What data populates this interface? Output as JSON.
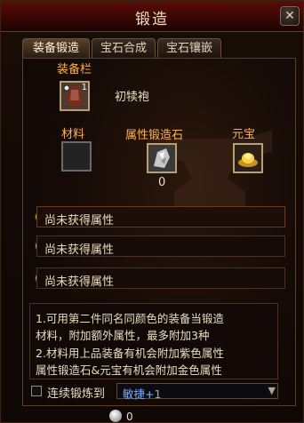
{
  "window": {
    "title": "锻造",
    "close_glyph": "✕"
  },
  "tabs": [
    {
      "label": "装备锻造",
      "active": true
    },
    {
      "label": "宝石合成",
      "active": false
    },
    {
      "label": "宝石镶嵌",
      "active": false
    }
  ],
  "equipment": {
    "label": "装备栏",
    "item_name": "初犊袍",
    "count": "1"
  },
  "material": {
    "label": "材料"
  },
  "forge_stone": {
    "label": "属性锻造石",
    "count": "0"
  },
  "yuanbao": {
    "label": "元宝"
  },
  "attributes": [
    {
      "text": "尚未获得属性",
      "icon": "gold-coin-icon"
    },
    {
      "text": "尚未获得属性",
      "icon": "silver-coin-icon"
    },
    {
      "text": "尚未获得属性",
      "icon": "silver-coin-icon"
    }
  ],
  "info_lines": [
    "1.可用第二件同名同颜色的装备当锻造",
    "  材料，附加额外属性，最多附加3种",
    "2.材料用上品装备有机会附加紫色属性",
    "  属性锻造石&元宝有机会附加金色属性"
  ],
  "continuous": {
    "label": "连续锻炼到",
    "selected": "敏捷+1"
  },
  "bottom": {
    "count": "0"
  },
  "colors": {
    "accent": "#ffb24a",
    "link": "#7ab0ff",
    "title_bg": "#3a0704"
  }
}
